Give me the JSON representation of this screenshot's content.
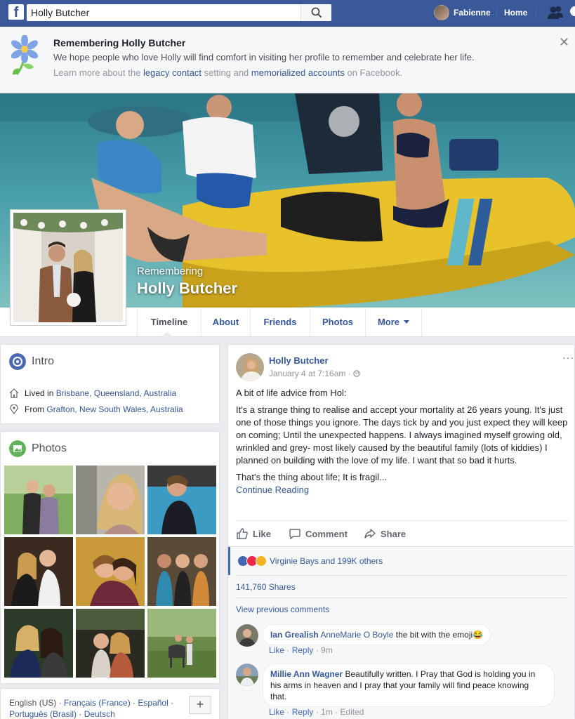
{
  "topbar": {
    "search_value": "Holly Butcher",
    "user_name": "Fabienne",
    "home_label": "Home"
  },
  "memorial": {
    "title": "Remembering Holly Butcher",
    "text": "We hope people who love Holly will find comfort in visiting her profile to remember and celebrate her life.",
    "learn_prefix": "Learn more about the",
    "legacy_link": "legacy contact",
    "learn_middle": "setting and",
    "memorialized_link": "memorialized accounts",
    "learn_suffix": "on Facebook."
  },
  "cover": {
    "remembering": "Remembering",
    "name": "Holly Butcher"
  },
  "tabs": [
    {
      "label": "Timeline"
    },
    {
      "label": "About"
    },
    {
      "label": "Friends"
    },
    {
      "label": "Photos"
    },
    {
      "label": "More"
    }
  ],
  "intro": {
    "title": "Intro",
    "lived_prefix": "Lived in",
    "lived_place": "Brisbane, Queensland, Australia",
    "from_prefix": "From",
    "from_place": "Grafton, New South Wales, Australia"
  },
  "photos": {
    "title": "Photos"
  },
  "languages": {
    "english": "English (US)",
    "francais": "Français (France)",
    "espanol": "Español",
    "portugues": "Português (Brasil)",
    "deutsch": "Deutsch"
  },
  "post": {
    "author": "Holly Butcher",
    "time": "January 4 at 7:16am",
    "line1": "A bit of life advice from Hol:",
    "para": "It's a strange thing to realise and accept your mortality at 26 years young. It's just one of those things you ignore. The days tick by and you just expect they will keep on coming; Until the unexpected happens. I always imagined myself growing old, wrinkled and grey- most likely caused by the beautiful family (lots of kiddies) I planned on building with the love of my life. I want that so bad it hurts.",
    "line3": "That's the thing about life; It is fragil...",
    "continue": "Continue Reading",
    "like": "Like",
    "comment": "Comment",
    "share": "Share",
    "reactions": "Virginie Bays and 199K others",
    "shares": "141,760 Shares",
    "view_previous": "View previous comments"
  },
  "comments": [
    {
      "name": "Ian Grealish",
      "tag": "AnneMarie O Boyle",
      "text": "the bit with the emoji😂",
      "like": "Like",
      "reply": "Reply",
      "time": "9m",
      "edited": ""
    },
    {
      "name": "Millie Ann Wagner",
      "tag": "",
      "text": "Beautifully written. I Pray that God is holding you in his arms in heaven and I pray that your family will find peace knowing that.",
      "like": "Like",
      "reply": "Reply",
      "time": "1m",
      "edited": "Edited"
    }
  ],
  "colors": {
    "brand": "#3b5998",
    "link": "#365899",
    "background": "#e9ebee"
  }
}
